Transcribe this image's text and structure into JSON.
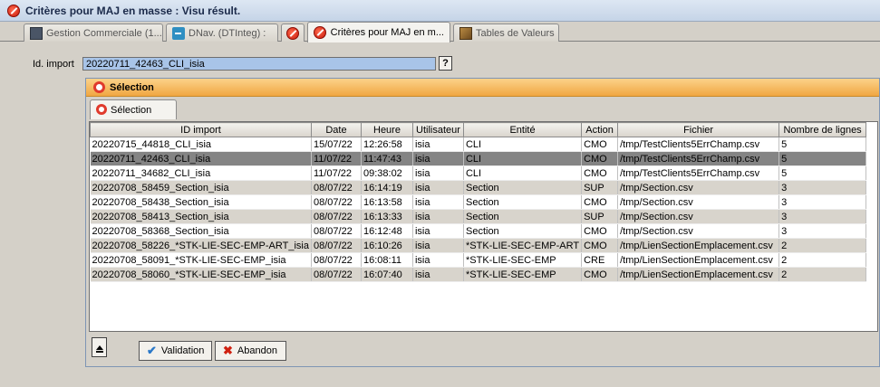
{
  "window": {
    "title": "Critères pour MAJ en masse : Visu résult."
  },
  "tabs": [
    {
      "label": "Gestion Commerciale (1..."
    },
    {
      "label": "DNav. (DTInteg) :"
    },
    {
      "label": ""
    },
    {
      "label": "Critères pour MAJ en m..."
    },
    {
      "label": "Tables de Valeurs"
    }
  ],
  "form": {
    "id_import_label": "Id. import",
    "id_import_value": "20220711_42463_CLI_isia",
    "help_label": "?"
  },
  "panel": {
    "title": "Sélection",
    "subtab_label": "Sélection"
  },
  "table": {
    "headers": [
      "ID import",
      "Date",
      "Heure",
      "Utilisateur",
      "Entité",
      "Action",
      "Fichier",
      "Nombre de lignes"
    ],
    "rows": [
      [
        "20220715_44818_CLI_isia",
        "15/07/22",
        "12:26:58",
        "isia",
        "CLI",
        "CMO",
        "/tmp/TestClients5ErrChamp.csv",
        "5"
      ],
      [
        "20220711_42463_CLI_isia",
        "11/07/22",
        "11:47:43",
        "isia",
        "CLI",
        "CMO",
        "/tmp/TestClients5ErrChamp.csv",
        "5"
      ],
      [
        "20220711_34682_CLI_isia",
        "11/07/22",
        "09:38:02",
        "isia",
        "CLI",
        "CMO",
        "/tmp/TestClients5ErrChamp.csv",
        "5"
      ],
      [
        "20220708_58459_Section_isia",
        "08/07/22",
        "16:14:19",
        "isia",
        "Section",
        "SUP",
        "/tmp/Section.csv",
        "3"
      ],
      [
        "20220708_58438_Section_isia",
        "08/07/22",
        "16:13:58",
        "isia",
        "Section",
        "CMO",
        "/tmp/Section.csv",
        "3"
      ],
      [
        "20220708_58413_Section_isia",
        "08/07/22",
        "16:13:33",
        "isia",
        "Section",
        "SUP",
        "/tmp/Section.csv",
        "3"
      ],
      [
        "20220708_58368_Section_isia",
        "08/07/22",
        "16:12:48",
        "isia",
        "Section",
        "CMO",
        "/tmp/Section.csv",
        "3"
      ],
      [
        "20220708_58226_*STK-LIE-SEC-EMP-ART_isia",
        "08/07/22",
        "16:10:26",
        "isia",
        "*STK-LIE-SEC-EMP-ART",
        "CMO",
        "/tmp/LienSectionEmplacement.csv",
        "2"
      ],
      [
        "20220708_58091_*STK-LIE-SEC-EMP_isia",
        "08/07/22",
        "16:08:11",
        "isia",
        "*STK-LIE-SEC-EMP",
        "CRE",
        "/tmp/LienSectionEmplacement.csv",
        "2"
      ],
      [
        "20220708_58060_*STK-LIE-SEC-EMP_isia",
        "08/07/22",
        "16:07:40",
        "isia",
        "*STK-LIE-SEC-EMP",
        "CMO",
        "/tmp/LienSectionEmplacement.csv",
        "2"
      ]
    ],
    "selected_row": 1
  },
  "buttons": {
    "validation": "Validation",
    "abandon": "Abandon"
  },
  "colors": {
    "selection_bg": "#848484",
    "panel_header": "#f0a742"
  }
}
